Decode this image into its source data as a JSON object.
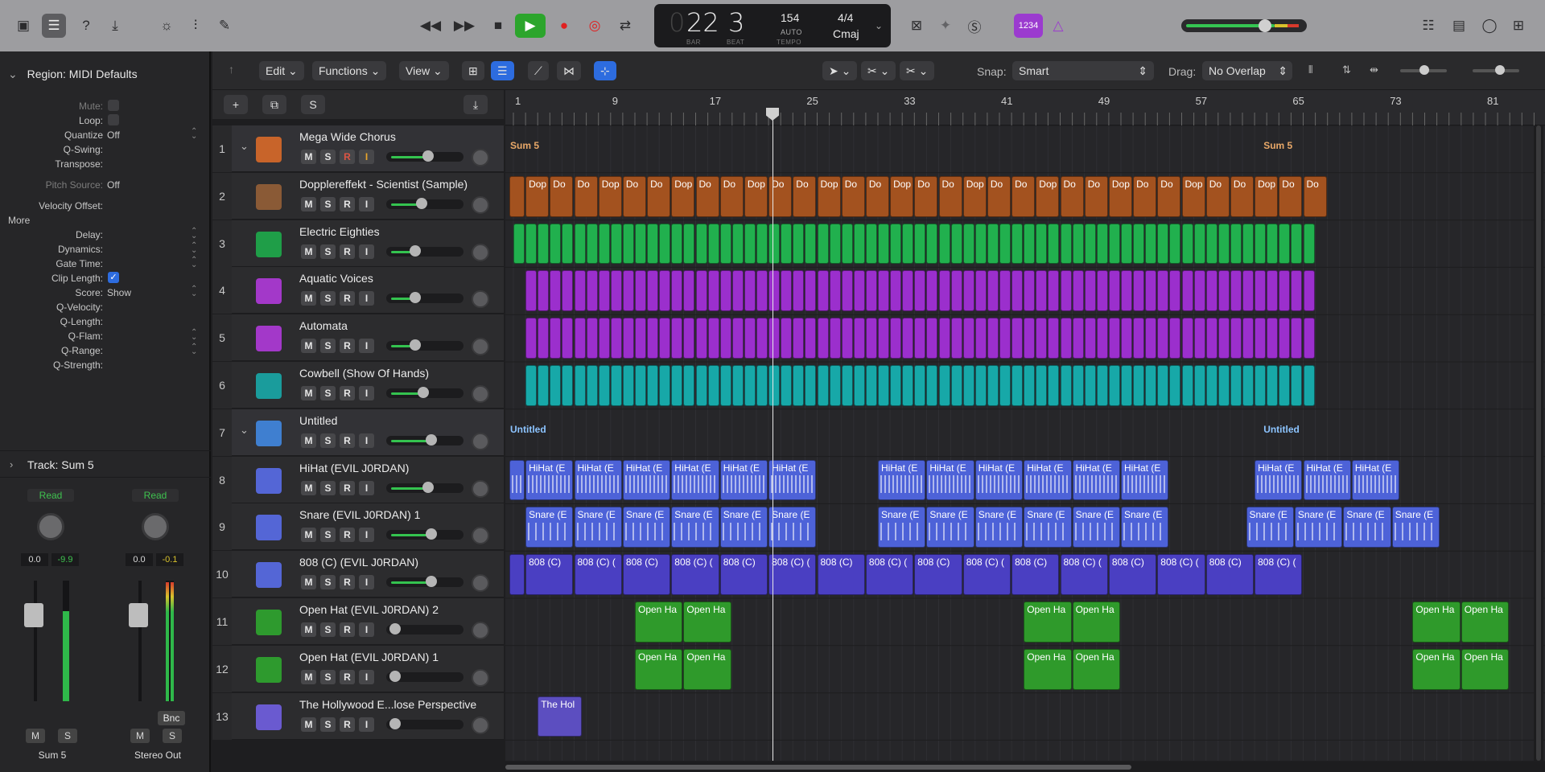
{
  "transport": {
    "bar": "22",
    "beat": "3",
    "bar_label": "BAR",
    "beat_label": "BEAT",
    "tempo": "154",
    "tempo_mode": "AUTO",
    "tempo_label": "TEMPO",
    "time_sig": "4/4",
    "key": "Cmaj",
    "count_in": "1234"
  },
  "inspector": {
    "region_title": "Region: MIDI Defaults",
    "rows": [
      {
        "label": "Mute:",
        "dim": true
      },
      {
        "label": "Loop:",
        "dim": false
      },
      {
        "label": "Quantize",
        "value": "Off"
      },
      {
        "label": "Q-Swing:"
      },
      {
        "label": "Transpose:"
      },
      {
        "label": "Pitch Source:",
        "value": "Off",
        "dim": true
      },
      {
        "label": "Velocity Offset:"
      },
      {
        "label": "More"
      },
      {
        "label": "Delay:"
      },
      {
        "label": "Dynamics:"
      },
      {
        "label": "Gate Time:"
      },
      {
        "label": "Clip Length:"
      },
      {
        "label": "Score:",
        "value": "Show"
      },
      {
        "label": "Q-Velocity:"
      },
      {
        "label": "Q-Length:"
      },
      {
        "label": "Q-Flam:"
      },
      {
        "label": "Q-Range:"
      },
      {
        "label": "Q-Strength:"
      }
    ],
    "track_title": "Track: Sum 5",
    "strip_left": {
      "read": "Read",
      "vol": "0.0",
      "peak": "-9.9",
      "name": "Sum 5",
      "m": "M",
      "s": "S"
    },
    "strip_right": {
      "read": "Read",
      "vol": "0.0",
      "peak": "-0.1",
      "name": "Stereo Out",
      "m": "M",
      "s": "S",
      "bnc": "Bnc"
    }
  },
  "toolbar": {
    "edit": "Edit",
    "functions": "Functions",
    "view": "View",
    "snap_label": "Snap:",
    "snap_value": "Smart",
    "drag_label": "Drag:",
    "drag_value": "No Overlap",
    "s_label": "S"
  },
  "ruler": [
    "1",
    "9",
    "17",
    "25",
    "33",
    "41",
    "49",
    "57",
    "65",
    "73",
    "81"
  ],
  "tracks": [
    {
      "num": "1",
      "name": "Mega Wide Chorus",
      "color": "#c8642a"
    },
    {
      "num": "2",
      "name": "Dopplereffekt - Scientist (Sample)",
      "color": "#8a5a36"
    },
    {
      "num": "3",
      "name": "Electric Eighties",
      "color": "#1f9e48"
    },
    {
      "num": "4",
      "name": "Aquatic Voices",
      "color": "#a338c9"
    },
    {
      "num": "5",
      "name": "Automata",
      "color": "#a338c9"
    },
    {
      "num": "6",
      "name": "Cowbell (Show Of Hands)",
      "color": "#1a9c9c"
    },
    {
      "num": "7",
      "name": "Untitled",
      "color": "#3f7fd0"
    },
    {
      "num": "8",
      "name": "HiHat (EVIL J0RDAN)",
      "color": "#5466d6"
    },
    {
      "num": "9",
      "name": "Snare (EVIL J0RDAN) 1",
      "color": "#5466d6"
    },
    {
      "num": "10",
      "name": "808 (C) (EVIL J0RDAN)",
      "color": "#5466d6"
    },
    {
      "num": "11",
      "name": "Open Hat (EVIL J0RDAN) 2",
      "color": "#2e9a2e"
    },
    {
      "num": "12",
      "name": "Open Hat (EVIL J0RDAN) 1",
      "color": "#2e9a2e"
    },
    {
      "num": "13",
      "name": "The Hollywood E...lose Perspective",
      "color": "#6a5ad0"
    }
  ],
  "msri": {
    "m": "M",
    "s": "S",
    "r": "R",
    "i": "I"
  },
  "regions": {
    "sum5": "Sum 5",
    "untitled": "Untitled",
    "dop_a": "Do",
    "dop_b": "Dop",
    "hihat": "HiHat (E",
    "snare": "Snare (E",
    "r808": "808 (C)",
    "r808b": "808 (C) (",
    "openhat": "Open Ha",
    "hollywood": "The Hol"
  },
  "colors": {
    "brown": "#a3521f",
    "green": "#21b04e",
    "purple": "#9b2fcd",
    "teal": "#17a8a8",
    "blue": "#4d62d8",
    "indigo": "#4a3fc2",
    "ohgreen": "#2f9a2b"
  }
}
